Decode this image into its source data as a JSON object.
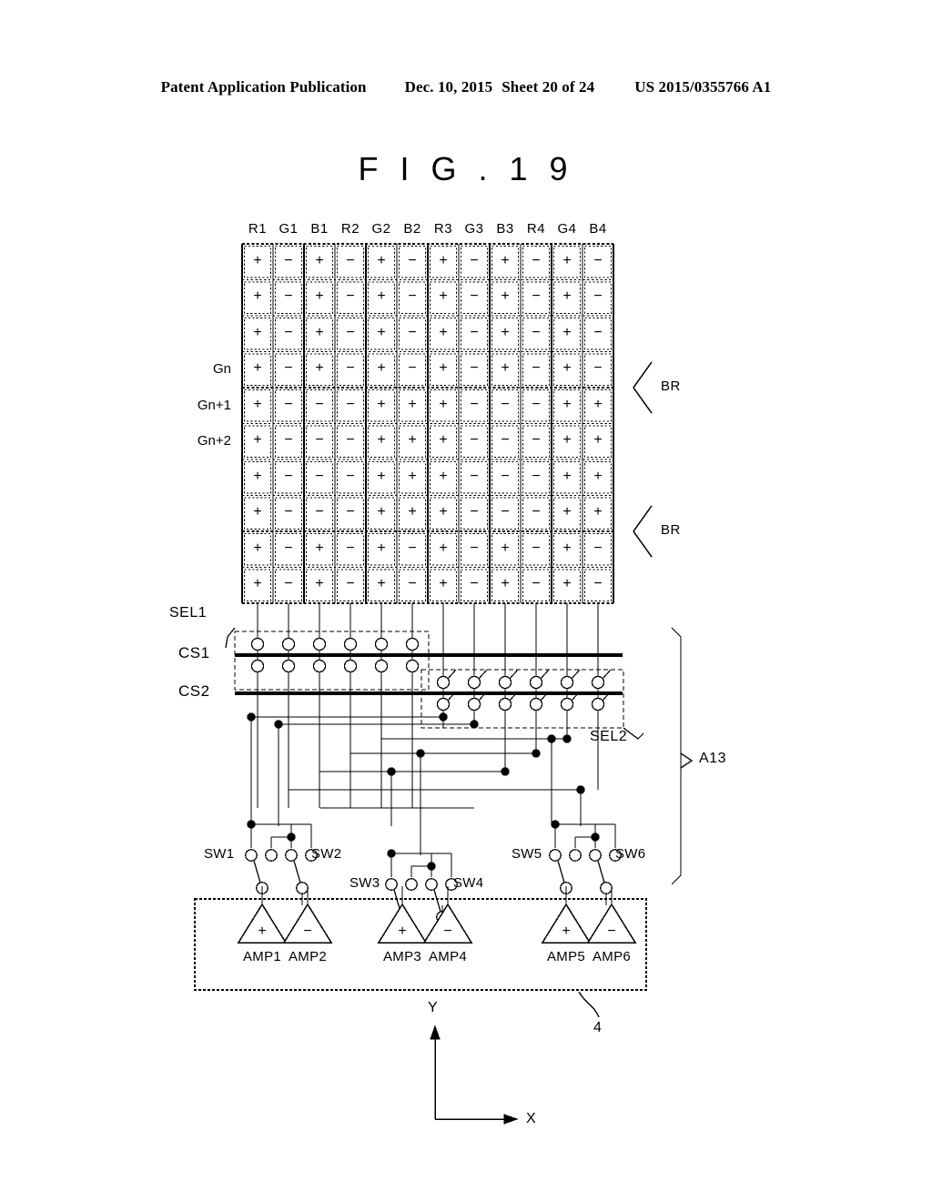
{
  "header": {
    "publication": "Patent Application Publication",
    "date": "Dec. 10, 2015",
    "sheet": "Sheet 20 of 24",
    "number": "US 2015/0355766 A1"
  },
  "figure": {
    "title": "F I G . 1 9"
  },
  "grid": {
    "columns": [
      "R1",
      "G1",
      "B1",
      "R2",
      "G2",
      "B2",
      "R3",
      "G3",
      "B3",
      "R4",
      "G4",
      "B4"
    ],
    "row_labels": {
      "3": "Gn",
      "4": "Gn+1",
      "5": "Gn+2"
    },
    "rows": [
      [
        "+",
        "−",
        "+",
        "−",
        "+",
        "−",
        "+",
        "−",
        "+",
        "−",
        "+",
        "−"
      ],
      [
        "+",
        "−",
        "+",
        "−",
        "+",
        "−",
        "+",
        "−",
        "+",
        "−",
        "+",
        "−"
      ],
      [
        "+",
        "−",
        "+",
        "−",
        "+",
        "−",
        "+",
        "−",
        "+",
        "−",
        "+",
        "−"
      ],
      [
        "+",
        "−",
        "+",
        "−",
        "+",
        "−",
        "+",
        "−",
        "+",
        "−",
        "+",
        "−"
      ],
      [
        "+",
        "−",
        "−",
        "−",
        "+",
        "+",
        "+",
        "−",
        "−",
        "−",
        "+",
        "+"
      ],
      [
        "+",
        "−",
        "−",
        "−",
        "+",
        "+",
        "+",
        "−",
        "−",
        "−",
        "+",
        "+"
      ],
      [
        "+",
        "−",
        "−",
        "−",
        "+",
        "+",
        "+",
        "−",
        "−",
        "−",
        "+",
        "+"
      ],
      [
        "+",
        "−",
        "−",
        "−",
        "+",
        "+",
        "+",
        "−",
        "−",
        "−",
        "+",
        "+"
      ],
      [
        "+",
        "−",
        "+",
        "−",
        "+",
        "−",
        "+",
        "−",
        "+",
        "−",
        "+",
        "−"
      ],
      [
        "+",
        "−",
        "+",
        "−",
        "+",
        "−",
        "+",
        "−",
        "+",
        "−",
        "+",
        "−"
      ]
    ],
    "block_breaks": [
      4,
      8
    ],
    "br_labels": [
      "BR",
      "BR"
    ]
  },
  "select": {
    "sel1": "SEL1",
    "sel2": "SEL2"
  },
  "bus": {
    "cs1": "CS1",
    "cs2": "CS2"
  },
  "switches": {
    "labels": [
      "SW1",
      "SW2",
      "SW3",
      "SW4",
      "SW5",
      "SW6"
    ]
  },
  "amplifiers": {
    "labels": [
      "AMP1",
      "AMP2",
      "AMP3",
      "AMP4",
      "AMP5",
      "AMP6"
    ],
    "signs": [
      "+",
      "−",
      "+",
      "−",
      "+",
      "−"
    ]
  },
  "annotations": {
    "a13": "A13",
    "driver_ref": "4",
    "axis_x": "X",
    "axis_y": "Y"
  },
  "colors": {
    "ink": "#000000",
    "background": "#ffffff"
  }
}
